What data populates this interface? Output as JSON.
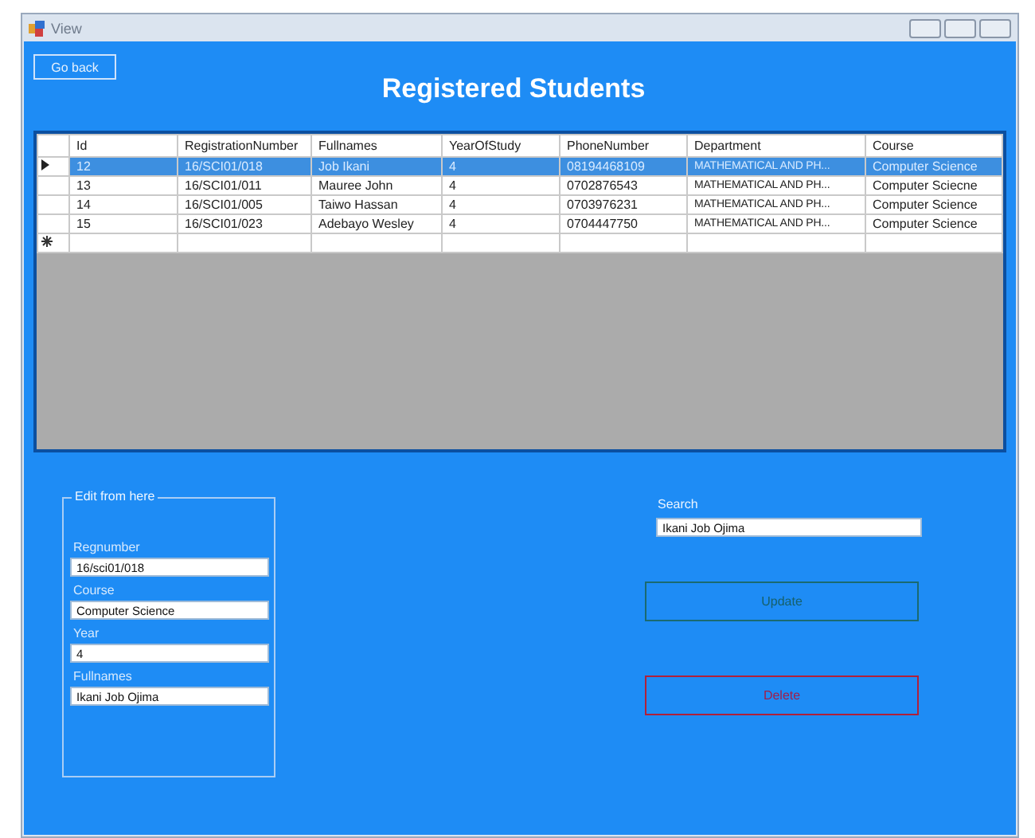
{
  "window": {
    "title": "View"
  },
  "back_button": "Go back",
  "heading": "Registered Students",
  "table": {
    "columns": [
      "Id",
      "RegistrationNumber",
      "Fullnames",
      "YearOfStudy",
      "PhoneNumber",
      "Department",
      "Course"
    ],
    "rows": [
      {
        "selected": true,
        "cells": [
          "12",
          "16/SCI01/018",
          "Job Ikani",
          "4",
          "08194468109",
          "MATHEMATICAL AND PH...",
          "Computer Science"
        ]
      },
      {
        "selected": false,
        "cells": [
          "13",
          "16/SCI01/011",
          "Mauree John",
          "4",
          "0702876543",
          "MATHEMATICAL AND PH...",
          "Computer Sciecne"
        ]
      },
      {
        "selected": false,
        "cells": [
          "14",
          "16/SCI01/005",
          "Taiwo Hassan",
          "4",
          "0703976231",
          "MATHEMATICAL AND PH...",
          "Computer Science"
        ]
      },
      {
        "selected": false,
        "cells": [
          "15",
          "16/SCI01/023",
          "Adebayo Wesley",
          "4",
          "0704447750",
          "MATHEMATICAL AND PH...",
          "Computer Science"
        ]
      }
    ],
    "new_row": true
  },
  "edit_group": {
    "title": "Edit from here",
    "fields": [
      {
        "label": "Regnumber",
        "value": "16/sci01/018"
      },
      {
        "label": "Course",
        "value": "Computer Science"
      },
      {
        "label": "Year",
        "value": "4"
      },
      {
        "label": "Fullnames",
        "value": "Ikani Job Ojima"
      }
    ]
  },
  "search": {
    "label": "Search",
    "value": "Ikani Job Ojima"
  },
  "buttons": [
    {
      "label": "Update",
      "kind": "update"
    },
    {
      "label": "Delete",
      "kind": "delete"
    }
  ]
}
